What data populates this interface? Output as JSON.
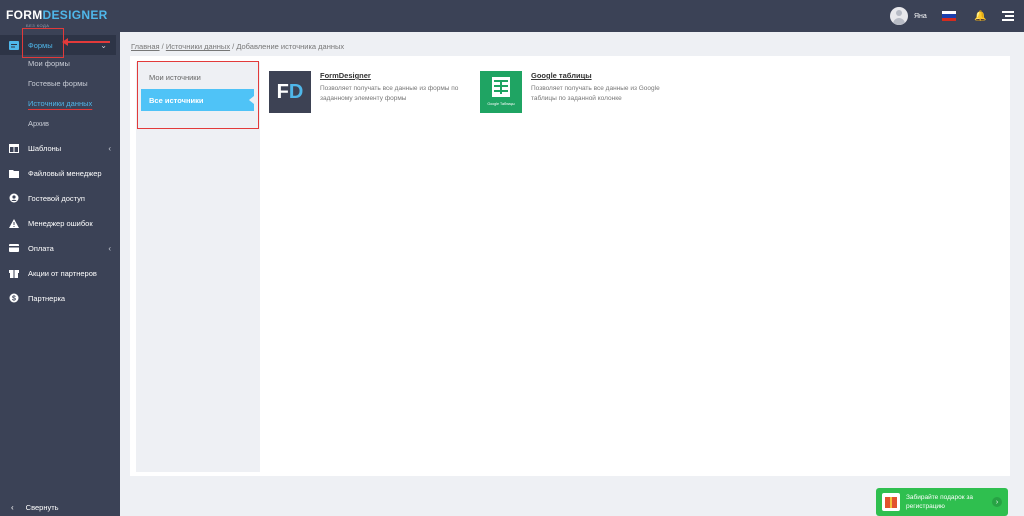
{
  "app": {
    "logo_part1": "FORM",
    "logo_part2": "DESIGNER",
    "logo_sub": "БЕЗ КОДА"
  },
  "topbar": {
    "user_name": "Яна",
    "flag_colors": [
      "#ffffff",
      "#1c3fad",
      "#d52b1e"
    ]
  },
  "sidebar": {
    "forms_label": "Формы",
    "sub_items": [
      "Мои формы",
      "Гостевые формы",
      "Источники данных",
      "Архив"
    ],
    "items": [
      {
        "label": "Шаблоны",
        "icon": "templates-icon"
      },
      {
        "label": "Файловый менеджер",
        "icon": "file-manager-icon"
      },
      {
        "label": "Гостевой доступ",
        "icon": "guest-access-icon"
      },
      {
        "label": "Менеджер ошибок",
        "icon": "warning-icon"
      },
      {
        "label": "Оплата",
        "icon": "payment-icon"
      },
      {
        "label": "Акции от партнеров",
        "icon": "gift-icon"
      },
      {
        "label": "Партнерка",
        "icon": "dollar-icon"
      }
    ],
    "collapse_label": "Свернуть"
  },
  "breadcrumb": {
    "home": "Главная",
    "sources": "Источники данных",
    "current": "Добавление источника данных",
    "sep1": " / ",
    "sep2": " / "
  },
  "tabs": {
    "my": "Мои источники",
    "all": "Все источники"
  },
  "sources": [
    {
      "title": "FormDesigner",
      "description": "Позволяет получать все данные из формы по заданному элементу формы",
      "logo_text_a": "F",
      "logo_text_b": "D"
    },
    {
      "title": "Google таблицы",
      "description": "Позволяет получать все данные из Google таблицы по заданной колонке",
      "logo_caption": "Google Таблицы"
    }
  ],
  "promo": {
    "text": "Забирайте подарок за регистрацию"
  },
  "colors": {
    "accent": "#4fb7ea",
    "sidebar_bg": "#3b4256",
    "highlight_red": "#e23a3a",
    "promo_green": "#2fbf4f",
    "sheets_green": "#1fa463"
  }
}
